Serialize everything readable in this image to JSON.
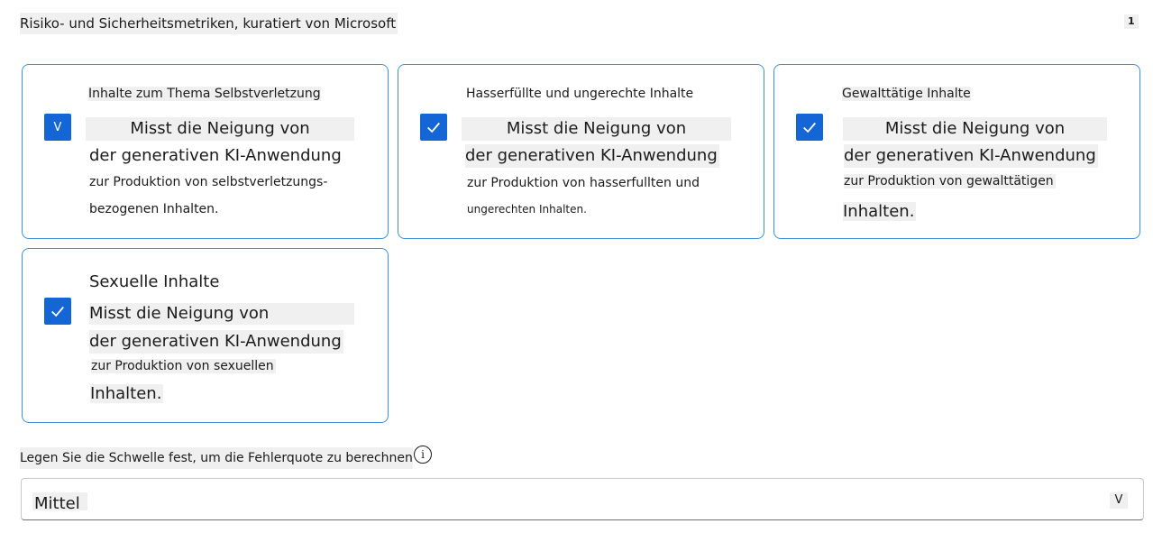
{
  "section": {
    "title": "Risiko- und Sicherheitsmetriken, kuratiert von Microsoft",
    "count": "1"
  },
  "cards": [
    {
      "title": "Inhalte zum Thema Selbstverletzung",
      "checked": true,
      "lines": [
        "Misst die Neigung von",
        "der generativen KI-Anwendung",
        "zur Produktion von selbstverletzungs-",
        "bezogenen Inhalten."
      ]
    },
    {
      "title": "Hasserfüllte und ungerechte Inhalte",
      "checked": true,
      "lines": [
        "Misst die Neigung von",
        "der generativen KI-Anwendung",
        "zur Produktion von hasserfullten und",
        "ungerechten Inhalten."
      ]
    },
    {
      "title": "Gewalttätige Inhalte",
      "checked": true,
      "lines": [
        "Misst die Neigung von",
        "der generativen KI-Anwendung",
        "zur Produktion von gewalttätigen",
        "Inhalten."
      ]
    },
    {
      "title": "Sexuelle Inhalte",
      "checked": true,
      "lines": [
        "Misst die Neigung von",
        "der generativen KI-Anwendung",
        "zur Produktion von sexuellen",
        "Inhalten."
      ]
    }
  ],
  "threshold": {
    "label": "Legen Sie die Schwelle fest, um die Fehlerquote zu berechnen",
    "info_icon": "i",
    "selected": "Mittel",
    "chevron": "V"
  },
  "colors": {
    "checkbox": "#1465d6",
    "card_border": "#3d8fd9"
  }
}
